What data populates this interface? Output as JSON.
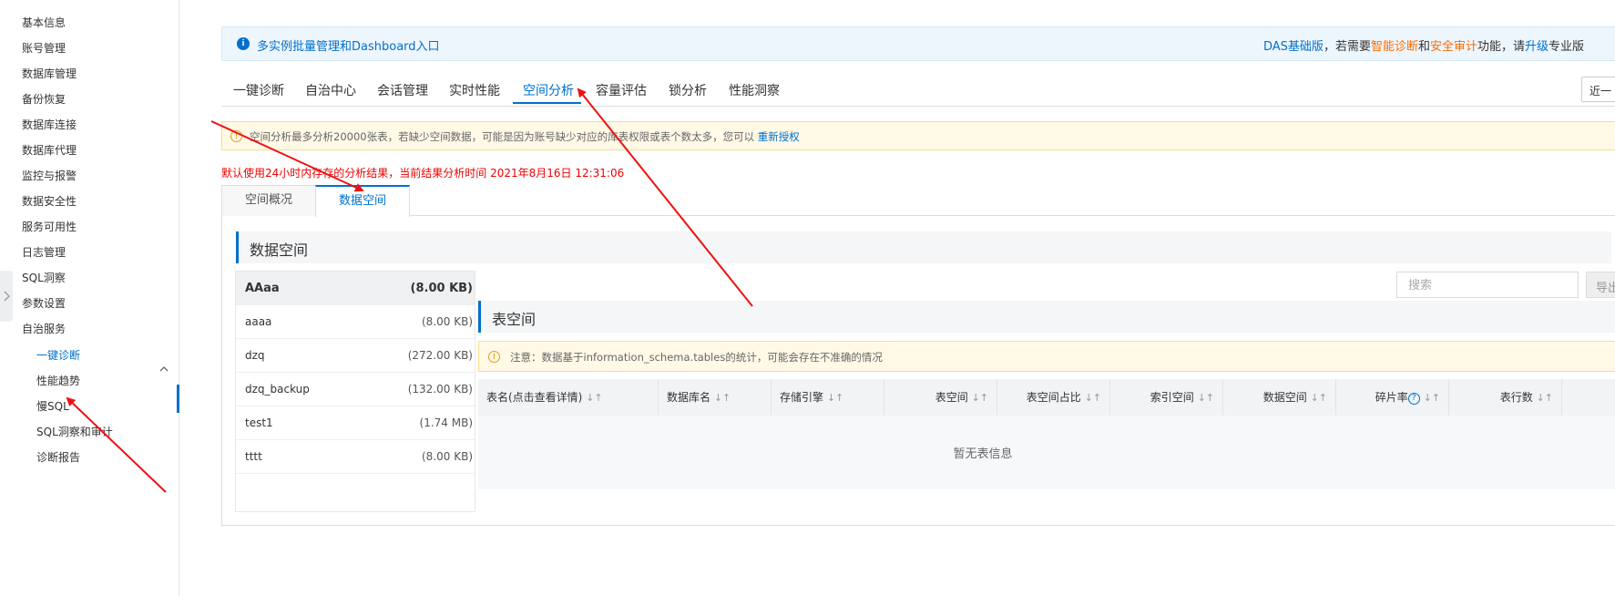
{
  "sidebar": {
    "items": [
      {
        "label": "基本信息"
      },
      {
        "label": "账号管理"
      },
      {
        "label": "数据库管理"
      },
      {
        "label": "备份恢复"
      },
      {
        "label": "数据库连接"
      },
      {
        "label": "数据库代理"
      },
      {
        "label": "监控与报警"
      },
      {
        "label": "数据安全性"
      },
      {
        "label": "服务可用性"
      },
      {
        "label": "日志管理"
      },
      {
        "label": "SQL洞察"
      },
      {
        "label": "参数设置"
      },
      {
        "label": "自治服务"
      }
    ],
    "sub_items": [
      {
        "label": "一键诊断",
        "active": true
      },
      {
        "label": "性能趋势"
      },
      {
        "label": "慢SQL"
      },
      {
        "label": "SQL洞察和审计"
      },
      {
        "label": "诊断报告"
      }
    ]
  },
  "banner": {
    "left_text": "多实例批量管理和Dashboard入口",
    "right_prefix": "DAS基础版",
    "right_mid1": "，若需要",
    "right_smart": "智能诊断",
    "right_and": "和",
    "right_security": "安全审计",
    "right_mid2": "功能，请",
    "right_upgrade": "升级",
    "right_suffix": "专业版"
  },
  "main_tabs": [
    {
      "label": "一键诊断"
    },
    {
      "label": "自治中心"
    },
    {
      "label": "会话管理"
    },
    {
      "label": "实时性能"
    },
    {
      "label": "空间分析",
      "active": true
    },
    {
      "label": "容量评估"
    },
    {
      "label": "锁分析"
    },
    {
      "label": "性能洞察"
    }
  ],
  "time_range": "近一",
  "warning": {
    "text": "空间分析最多分析20000张表，若缺少空间数据，可能是因为账号缺少对应的库表权限或表个数太多，您可以",
    "link": "重新授权"
  },
  "analysis_note": "默认使用24小时内存存的分析结果，当前结果分析时间 2021年8月16日 12:31:06",
  "sub_tabs": [
    {
      "label": "空间概况"
    },
    {
      "label": "数据空间",
      "active": true
    }
  ],
  "section_title": "数据空间",
  "databases": [
    {
      "name": "AAaa",
      "size": "(8.00 KB)",
      "header": true
    },
    {
      "name": "aaaa",
      "size": "(8.00 KB)"
    },
    {
      "name": "dzq",
      "size": "(272.00 KB)"
    },
    {
      "name": "dzq_backup",
      "size": "(132.00 KB)"
    },
    {
      "name": "test1",
      "size": "(1.74 MB)"
    },
    {
      "name": "tttt",
      "size": "(8.00 KB)"
    }
  ],
  "search": {
    "placeholder": "搜索"
  },
  "export_label": "导出",
  "tablespace_title": "表空间",
  "tablespace_notice": "注意：数据基于information_schema.tables的统计，可能会存在不准确的情况",
  "table": {
    "columns": [
      "表名(点击查看详情)",
      "数据库名",
      "存储引擎",
      "表空间",
      "表空间占比",
      "索引空间",
      "数据空间",
      "碎片率",
      "表行数"
    ],
    "empty_text": "暂无表信息"
  },
  "colors": {
    "accent": "#0070cc",
    "orange": "#ff6a00",
    "error": "#ee0000",
    "arrow": "#ee1111"
  }
}
